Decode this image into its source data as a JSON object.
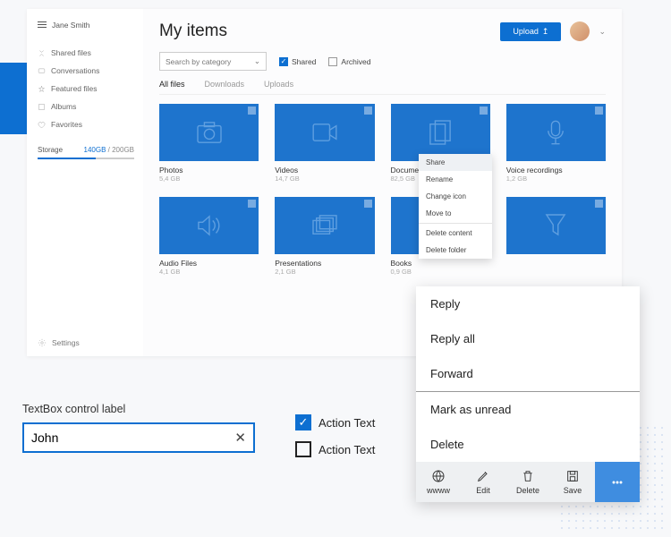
{
  "user": {
    "name": "Jane Smith"
  },
  "nav": [
    {
      "label": "Shared files"
    },
    {
      "label": "Conversations"
    },
    {
      "label": "Featured files"
    },
    {
      "label": "Albums"
    },
    {
      "label": "Favorites"
    }
  ],
  "storage": {
    "label": "Storage",
    "used": "140GB",
    "capacity": "200GB"
  },
  "settings_label": "Settings",
  "header": {
    "title": "My items",
    "upload": "Upload"
  },
  "filters": {
    "dropdown_placeholder": "Search by category",
    "shared": "Shared",
    "archived": "Archived"
  },
  "tabs": [
    "All files",
    "Downloads",
    "Uploads"
  ],
  "cards": [
    {
      "title": "Photos",
      "sub": "5,4 GB"
    },
    {
      "title": "Videos",
      "sub": "14,7 GB"
    },
    {
      "title": "Documents",
      "sub": "82,5 GB"
    },
    {
      "title": "Voice recordings",
      "sub": "1,2 GB"
    },
    {
      "title": "Audio Files",
      "sub": "4,1 GB"
    },
    {
      "title": "Presentations",
      "sub": "2,1 GB"
    },
    {
      "title": "Books",
      "sub": "0,9 GB"
    },
    {
      "title": "",
      "sub": ""
    }
  ],
  "context_menu": [
    "Share",
    "Rename",
    "Change icon",
    "Move to",
    "Delete content",
    "Delete folder"
  ],
  "textbox": {
    "label": "TextBox control label",
    "value": "John"
  },
  "action_text": "Action Text",
  "panel": {
    "items": [
      "Reply",
      "Reply all",
      "Forward",
      "Mark as unread",
      "Delete"
    ],
    "bar": [
      "wwww",
      "Edit",
      "Delete",
      "Save",
      ""
    ]
  }
}
